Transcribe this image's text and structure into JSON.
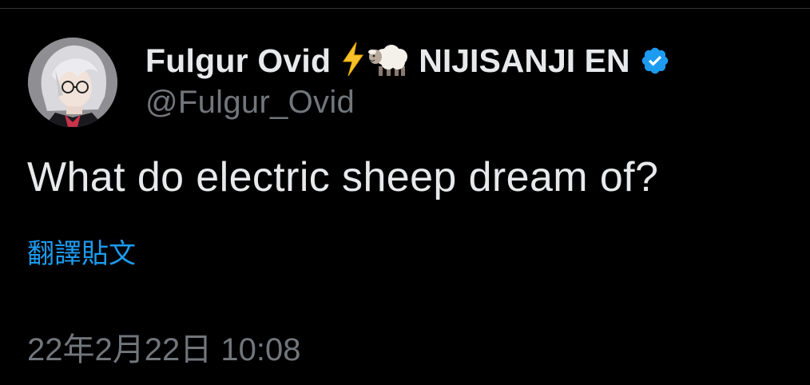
{
  "tweet": {
    "author": {
      "display_name": "Fulgur Ovid",
      "emoji_1": "high-voltage-emoji",
      "emoji_2": "sheep-emoji",
      "display_name_suffix": "NIJISANJI EN",
      "verified_icon": "verified-badge-icon",
      "handle": "@Fulgur_Ovid"
    },
    "text": "What do electric sheep dream of?",
    "translate_label": "翻譯貼文",
    "timestamp": "22年2月22日 10:08"
  },
  "colors": {
    "background": "#000000",
    "primary_text": "#e7e9ea",
    "secondary_text": "#71767b",
    "accent": "#1d9bf0",
    "divider": "#2f3336"
  }
}
